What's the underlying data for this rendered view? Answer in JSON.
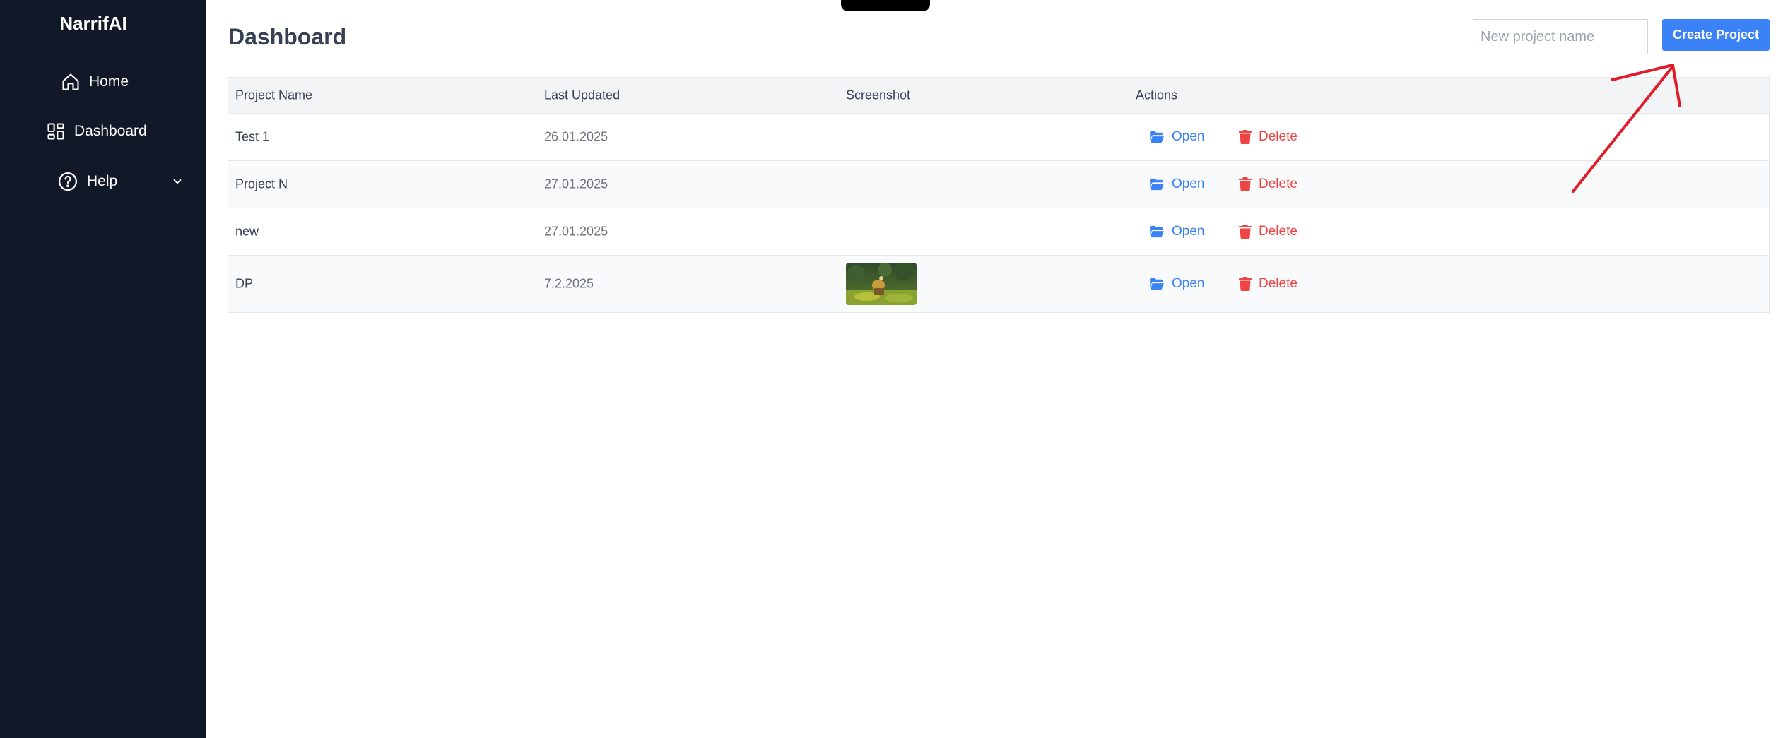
{
  "app": {
    "brand": "NarrifAI"
  },
  "sidebar": {
    "items": [
      {
        "label": "Home",
        "icon": "home-icon"
      },
      {
        "label": "Dashboard",
        "icon": "dashboard-icon"
      },
      {
        "label": "Help",
        "icon": "help-circle-icon"
      }
    ]
  },
  "page": {
    "title": "Dashboard"
  },
  "create": {
    "placeholder": "New project name",
    "value": "",
    "button_label": "Create Project"
  },
  "table": {
    "headers": [
      "Project Name",
      "Last Updated",
      "Screenshot",
      "Actions"
    ],
    "open_label": "Open",
    "delete_label": "Delete",
    "rows": [
      {
        "name": "Test 1",
        "updated": "26.01.2025",
        "has_screenshot": false
      },
      {
        "name": "Project N",
        "updated": "27.01.2025",
        "has_screenshot": false
      },
      {
        "name": "new",
        "updated": "27.01.2025",
        "has_screenshot": false
      },
      {
        "name": "DP",
        "updated": "7.2.2025",
        "has_screenshot": true
      }
    ]
  },
  "colors": {
    "sidebar_bg": "#111827",
    "accent": "#3b82f6",
    "danger": "#ef4444",
    "annotation": "#e11d2a"
  }
}
